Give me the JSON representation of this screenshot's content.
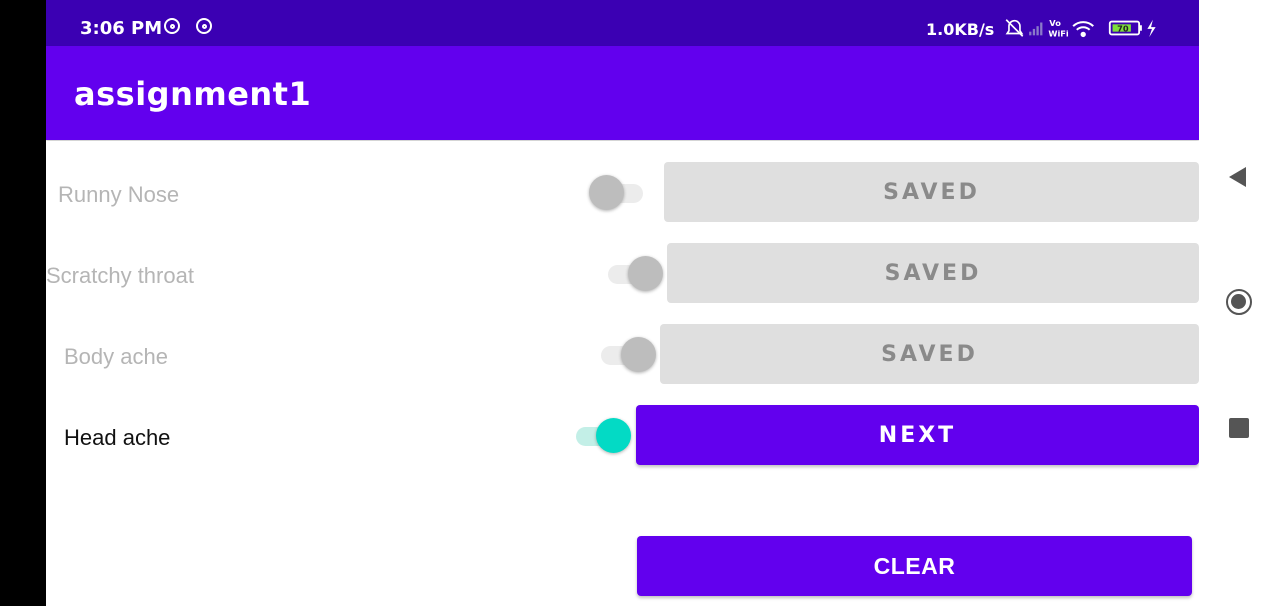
{
  "status_bar": {
    "time": "3:06 PM",
    "network_speed": "1.0KB/s",
    "volte_label_top": "Vo",
    "volte_label_bottom": "WiFi",
    "battery_level": "70",
    "icons": [
      "at-sign-icon",
      "at-sign-icon",
      "mute-bell-icon",
      "signal-icon",
      "vowifi-icon",
      "wifi-icon",
      "battery-icon",
      "charging-bolt-icon"
    ]
  },
  "app_bar": {
    "title": "assignment1"
  },
  "rows": [
    {
      "label": "Runny  Nose",
      "switch_on": false,
      "button": "SAVED"
    },
    {
      "label": "Scratchy throat",
      "switch_on": true,
      "button": "SAVED"
    },
    {
      "label": "Body ache",
      "switch_on": true,
      "button": "SAVED"
    },
    {
      "label": "Head ache",
      "switch_on": true,
      "button": "NEXT"
    }
  ],
  "clear_button": "CLEAR",
  "colors": {
    "status_bar": "#3b00b3",
    "primary": "#6200ee",
    "accent": "#03dac5",
    "saved_button": "#dfdfdf",
    "disabled_text": "#b5b5b5"
  },
  "nav_bar": {
    "icons": [
      "back-triangle-icon",
      "home-circle-icon",
      "recents-square-icon"
    ]
  }
}
